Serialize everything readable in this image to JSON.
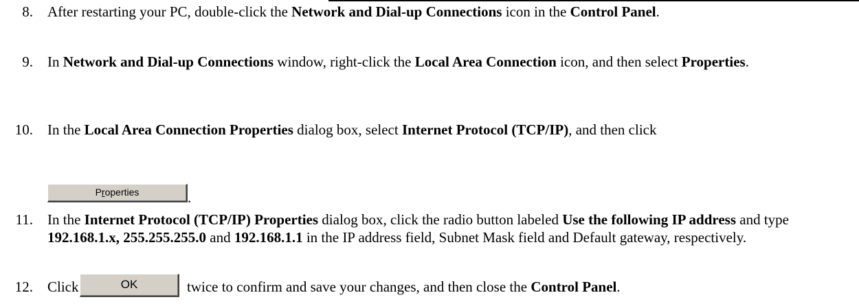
{
  "steps": [
    {
      "number": "8.",
      "parts": [
        "After restarting your PC, double-click the ",
        "Network and Dial-up Connections",
        " icon in the ",
        "Control Panel",
        "."
      ]
    },
    {
      "number": "9.",
      "parts": [
        "In ",
        "Network and Dial-up Connections",
        " window, right-click the ",
        "Local Area Connection",
        " icon, and then select ",
        "Properties",
        "."
      ]
    },
    {
      "number": "10.",
      "parts": [
        "In the ",
        "Local Area Connection Properties",
        " dialog box, select ",
        "Internet Protocol (TCP/IP)",
        ", and then click"
      ],
      "button": {
        "prefix": "P",
        "underlined": "r",
        "suffix": "operties"
      },
      "after_button": "."
    },
    {
      "number": "11.",
      "parts": [
        "In the ",
        "Internet Protocol (TCP/IP) Properties",
        " dialog box, click the radio button labeled ",
        "Use the following IP address",
        " and type ",
        "192.168.1.x, 255.255.255.0",
        " and ",
        "192.168.1.1",
        " in the IP address field, Subnet Mask field and Default gateway, respectively."
      ]
    },
    {
      "number": "12.",
      "prefix": "Click",
      "button_label": "OK",
      "parts": [
        " twice to confirm and save your changes, and then close the ",
        "Control Panel",
        "."
      ]
    }
  ]
}
